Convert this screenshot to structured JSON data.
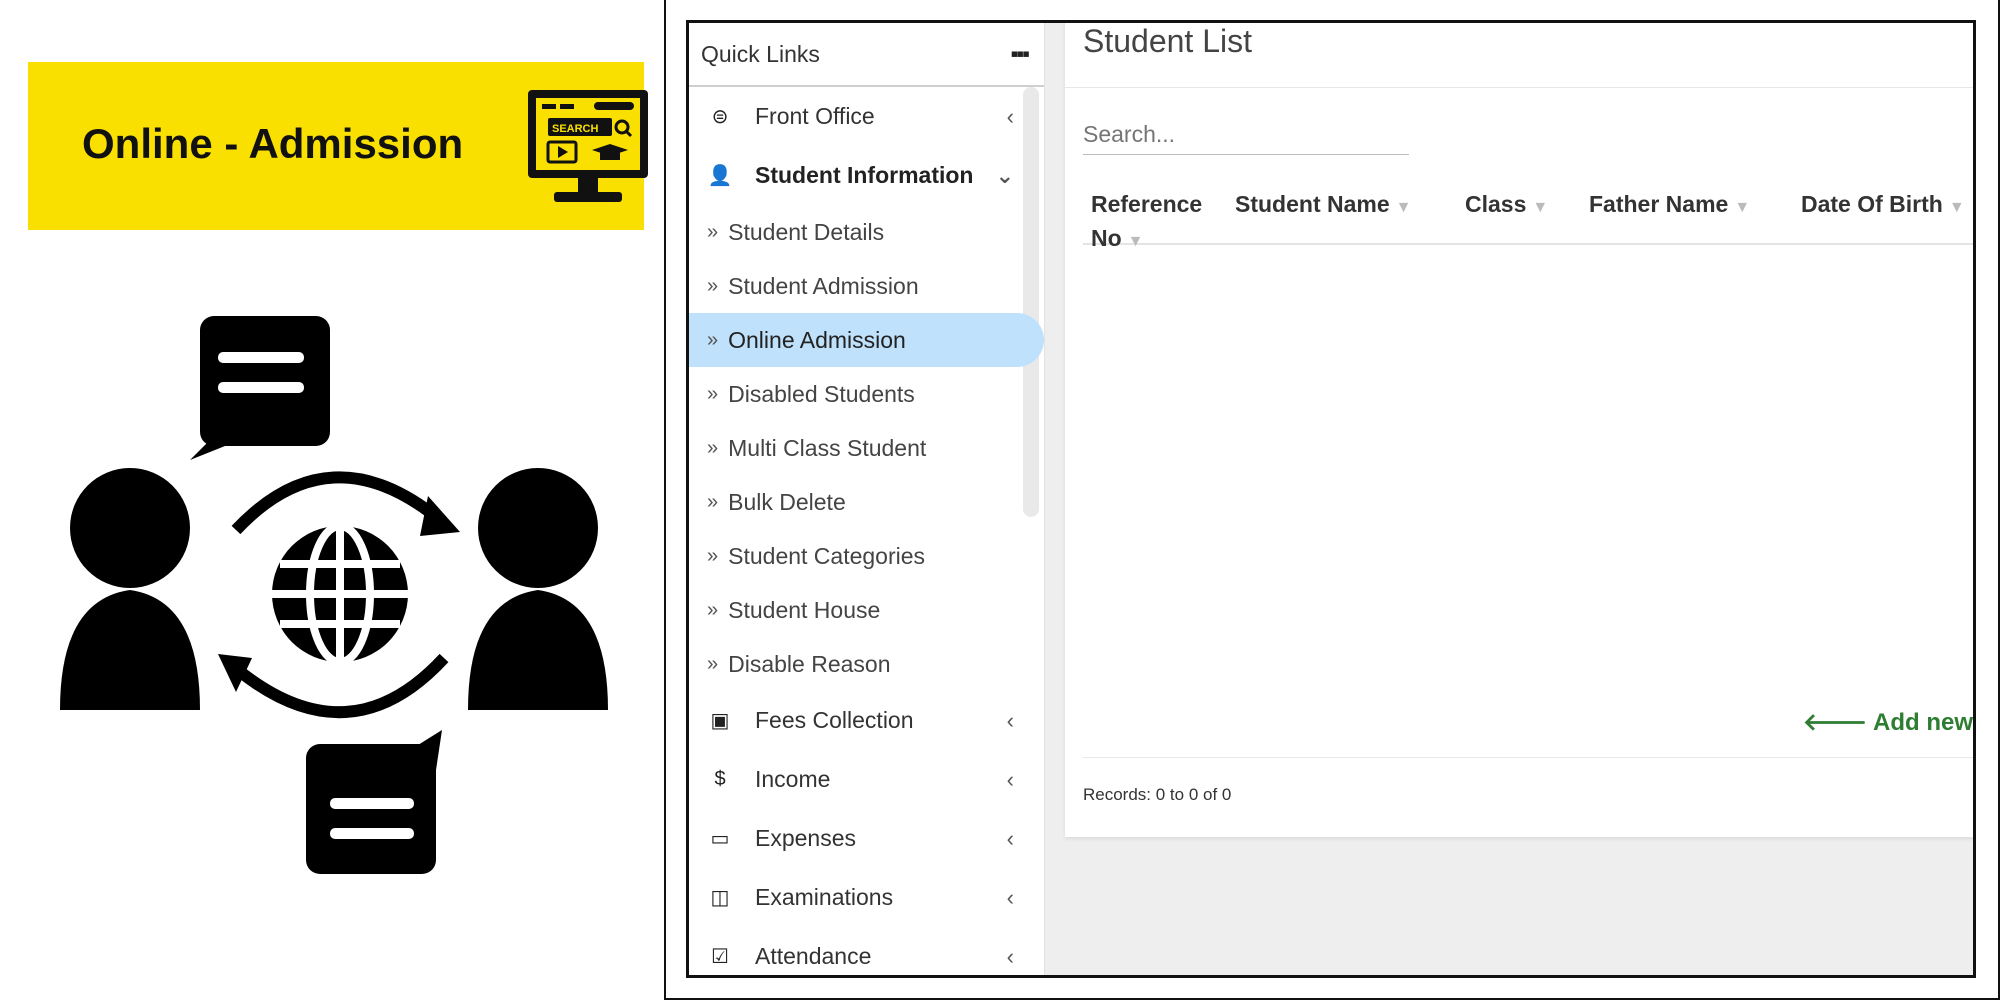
{
  "banner": {
    "title": "Online - Admission",
    "accent": "#f9e000",
    "icon_label": "SEARCH"
  },
  "sidebar": {
    "quick_links": "Quick Links",
    "items": [
      {
        "label": "Front Office",
        "icon": "tv-icon",
        "type": "main"
      },
      {
        "label": "Student Information",
        "icon": "user-plus-icon",
        "type": "main",
        "expanded": true
      },
      {
        "label": "Student Details",
        "type": "sub"
      },
      {
        "label": "Student Admission",
        "type": "sub"
      },
      {
        "label": "Online Admission",
        "type": "sub",
        "active": true
      },
      {
        "label": "Disabled Students",
        "type": "sub"
      },
      {
        "label": "Multi Class Student",
        "type": "sub"
      },
      {
        "label": "Bulk Delete",
        "type": "sub"
      },
      {
        "label": "Student Categories",
        "type": "sub"
      },
      {
        "label": "Student House",
        "type": "sub"
      },
      {
        "label": "Disable Reason",
        "type": "sub"
      },
      {
        "label": "Fees Collection",
        "icon": "money-icon",
        "type": "main"
      },
      {
        "label": "Income",
        "icon": "dollar-icon",
        "type": "main"
      },
      {
        "label": "Expenses",
        "icon": "credit-card-icon",
        "type": "main"
      },
      {
        "label": "Examinations",
        "icon": "map-icon",
        "type": "main"
      },
      {
        "label": "Attendance",
        "icon": "calendar-check-icon",
        "type": "main"
      }
    ],
    "active_color": "#bfe1fb"
  },
  "main": {
    "title": "Student List",
    "search_placeholder": "Search...",
    "columns": [
      "Reference No",
      "Student Name",
      "Class",
      "Father Name",
      "Date Of Birth"
    ],
    "add_new": "Add new",
    "records": "Records: 0 to 0 of 0"
  }
}
